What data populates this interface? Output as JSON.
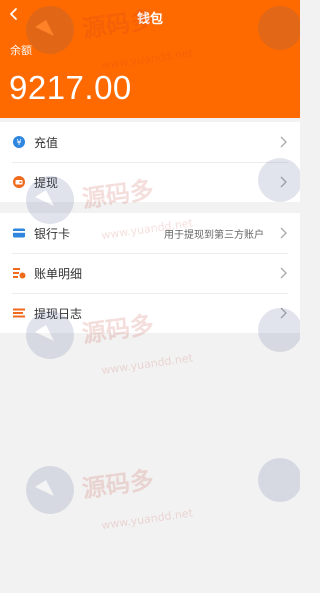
{
  "header": {
    "title": "钱包",
    "back_icon": "chevron-left-icon",
    "bg": "#ff6a00"
  },
  "balance": {
    "label": "余额",
    "amount": "9217.00"
  },
  "menu_group_1": [
    {
      "label": "充值",
      "icon": "recharge-coin-icon"
    },
    {
      "label": "提现",
      "icon": "withdraw-wallet-icon"
    }
  ],
  "menu_group_2": [
    {
      "label": "银行卡",
      "icon": "bank-card-icon",
      "note": "用于提现到第三方账户"
    },
    {
      "label": "账单明细",
      "icon": "bill-details-icon"
    },
    {
      "label": "提现日志",
      "icon": "withdraw-log-icon"
    }
  ],
  "watermark": {
    "brand": "源码多",
    "url": "www.yuandd.net"
  }
}
